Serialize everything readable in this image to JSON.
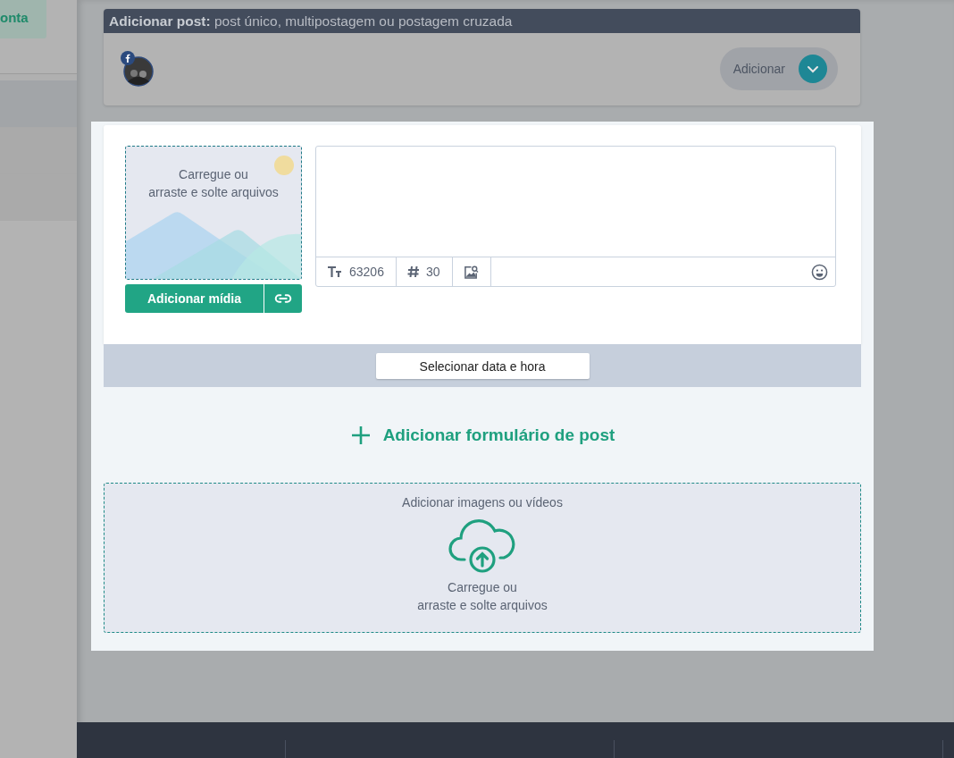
{
  "sidebar": {
    "account_button": "onta"
  },
  "add_post_card": {
    "title": "**Adicionar post:** post único, multipostagem ou postagem cruzada",
    "add_button": "Adicionar"
  },
  "post_form": {
    "media_upload": {
      "lines": [
        "Carregue ou",
        "arraste e solte arquivos"
      ]
    },
    "add_media_button": "Adicionar mídia",
    "editor": {
      "char_count": "63206",
      "hashtag_count": "30"
    },
    "schedule_button": "Selecionar data e hora"
  },
  "add_form_link": "Adicionar formulário de post",
  "bulk_upload": {
    "title": "Adicionar imagens ou vídeos",
    "lines": [
      "Carregue ou",
      "arraste e solte arquivos"
    ]
  }
}
